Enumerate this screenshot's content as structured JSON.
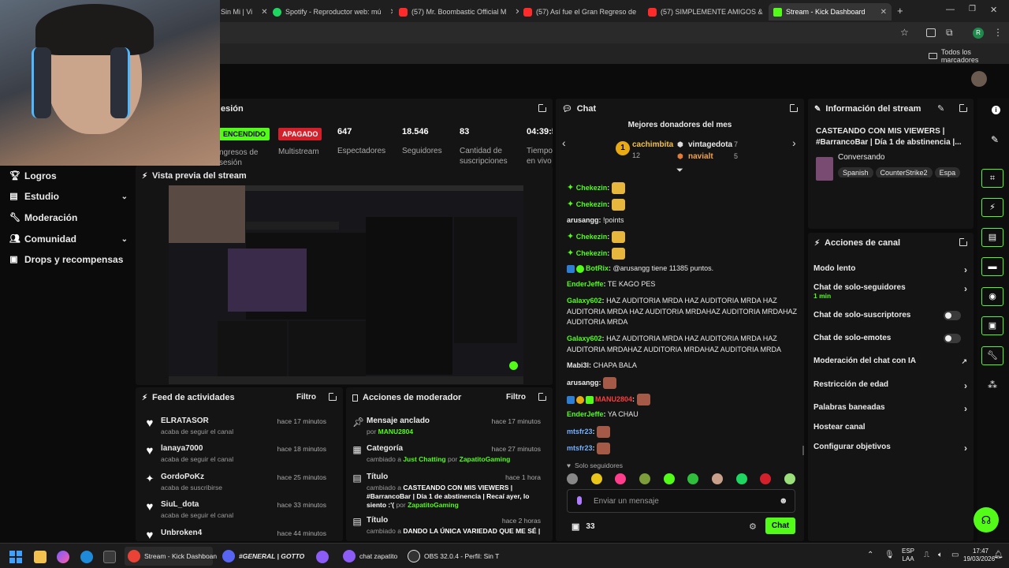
{
  "browser": {
    "tabs": [
      {
        "label": "Sin Mi | Vi",
        "color": "#888888"
      },
      {
        "label": "Spotify - Reproductor web: mú",
        "color": "#1ed760"
      },
      {
        "label": "(57) Mr. Boombastic Official M",
        "color": "#ff2b2b"
      },
      {
        "label": "(57) Así fue el Gran Regreso de",
        "color": "#ff2b2b"
      },
      {
        "label": "(57) SIMPLEMENTE AMIGOS &",
        "color": "#ff2b2b"
      },
      {
        "label": "Stream - Kick Dashboard",
        "color": "#53fc18"
      }
    ],
    "bookmarks_label": "Todos los marcadores",
    "profile_initial": "R"
  },
  "stats": {
    "session_title": "esión",
    "session_status": "ENCENDIDO",
    "session_label": "ngresos de sesión",
    "multistream_status": "APAGADO",
    "multistream_label": "Multistream",
    "viewers_value": "647",
    "viewers_label": "Espectadores",
    "followers_value": "18.546",
    "followers_label": "Seguidores",
    "subs_value": "83",
    "subs_label": "Cantidad de suscripciones",
    "time_value": "04:39:5",
    "time_label": "Tiempo en vivo"
  },
  "sidebar": {
    "items": [
      {
        "label": "Logros",
        "icon": "trophy-icon",
        "chevron": false
      },
      {
        "label": "Estudio",
        "icon": "book-icon",
        "chevron": true
      },
      {
        "label": "Moderación",
        "icon": "wrench-icon",
        "chevron": false
      },
      {
        "label": "Comunidad",
        "icon": "people-icon",
        "chevron": true
      },
      {
        "label": "Drops y recompensas",
        "icon": "gift-icon",
        "chevron": false
      }
    ]
  },
  "preview": {
    "title": "Vista previa del stream"
  },
  "feed": {
    "title": "Feed de actividades",
    "filter": "Filtro",
    "items": [
      {
        "name": "ELRATASOR",
        "desc": "acaba de seguir el canal",
        "time": "hace 17 minutos",
        "icon": "heart-icon"
      },
      {
        "name": "lanaya7000",
        "desc": "acaba de seguir el canal",
        "time": "hace 18 minutos",
        "icon": "heart-icon"
      },
      {
        "name": "GordoPoKz",
        "desc": "acaba de suscribirse",
        "time": "hace 25 minutos",
        "icon": "star-icon"
      },
      {
        "name": "SiuL_dota",
        "desc": "acaba de seguir el canal",
        "time": "hace 33 minutos",
        "icon": "heart-icon"
      },
      {
        "name": "Unbroken4",
        "desc": "",
        "time": "hace 44 minutos",
        "icon": "heart-icon"
      }
    ]
  },
  "modactions": {
    "title": "Acciones de moderador",
    "filter": "Filtro",
    "items": [
      {
        "name": "Mensaje anclado",
        "pre": "por ",
        "hl": "MANU2804",
        "mid": "",
        "hl2": "",
        "post": "",
        "time": "hace 17 minutos",
        "icon": "pin-icon"
      },
      {
        "name": "Categoría",
        "pre": "cambiado a ",
        "hl": "Just Chatting",
        "mid": " por ",
        "hl2": "ZapatitoGaming",
        "post": "",
        "time": "hace 27 minutos",
        "icon": "grid-icon"
      },
      {
        "name": "Título",
        "pre": "cambiado a ",
        "hl": "CASTEANDO CON MIS VIEWERS | #BarrancoBar | Día 1 de abstinencia | Recaí ayer, lo siento :'(",
        "mid": " por ",
        "hl2": "ZapatitoGaming",
        "post": "",
        "time": "hace 1 hora",
        "icon": "title-icon"
      },
      {
        "name": "Título",
        "pre": "cambiado a ",
        "hl": "DANDO LA ÚNICA VARIEDAD QUE ME SÉ |",
        "mid": "",
        "hl2": "",
        "post": "",
        "time": "hace 2 horas",
        "icon": "title-icon"
      }
    ]
  },
  "chat": {
    "title": "Chat",
    "donors_title": "Mejores donadores del mes",
    "donor1": {
      "name": "cachimbita",
      "amount": "12"
    },
    "donor2": {
      "name": "vintagedota",
      "amount": "7"
    },
    "donor3": {
      "name": "navialt",
      "amount": "5"
    },
    "messages": [
      {
        "user": "Chekezin",
        "text": "",
        "emote": true,
        "ucolor": "#53fc18"
      },
      {
        "user": "Chekezin",
        "text": "",
        "emote": true,
        "ucolor": "#53fc18"
      },
      {
        "user": "arusangg",
        "text": "!points",
        "emote": false,
        "ucolor": "#f0f0f0"
      },
      {
        "user": "Chekezin",
        "text": "",
        "emote": true,
        "ucolor": "#53fc18"
      },
      {
        "user": "Chekezin",
        "text": "",
        "emote": true,
        "ucolor": "#53fc18"
      },
      {
        "user": "BotRix",
        "text": "@arusangg tiene 11385 puntos.",
        "emote": false,
        "ucolor": "#53fc18"
      },
      {
        "user": "EnderJeffe",
        "text": "TE KAGO PES",
        "emote": false,
        "ucolor": "#53fc18"
      },
      {
        "user": "Galaxy602",
        "text": "HAZ AUDITORIA MRDA HAZ AUDITORIA MRDA HAZ AUDITORIA MRDA HAZ AUDITORIA MRDAHAZ AUDITORIA MRDAHAZ AUDITORIA MRDA",
        "emote": false,
        "ucolor": "#53fc18"
      },
      {
        "user": "Galaxy602",
        "text": "HAZ AUDITORIA MRDA HAZ AUDITORIA MRDA HAZ AUDITORIA MRDAHAZ AUDITORIA MRDAHAZ AUDITORIA MRDA",
        "emote": false,
        "ucolor": "#53fc18"
      },
      {
        "user": "Mabi3l",
        "text": "CHAPA BALA",
        "emote": false,
        "ucolor": "#f0f0f0"
      },
      {
        "user": "arusangg",
        "text": "",
        "emote": true,
        "ucolor": "#f0f0f0"
      },
      {
        "user": "MANU2804",
        "text": "",
        "emote": true,
        "ucolor": "#ff3d3d"
      },
      {
        "user": "EnderJeffe",
        "text": "YA CHAU",
        "emote": false,
        "ucolor": "#53fc18"
      },
      {
        "user": "mtsfr23",
        "text": "",
        "emote": true,
        "ucolor": "#74b0ff"
      },
      {
        "user": "mtsfr23",
        "text": "",
        "emote": true,
        "ucolor": "#74b0ff"
      }
    ],
    "followers_only": "Solo seguidores",
    "placeholder": "Enviar un mensaje",
    "count": "33",
    "send": "Chat"
  },
  "streaminfo": {
    "title": "Información del stream",
    "stream_title": "CASTEANDO CON MIS VIEWERS | #BarrancoBar | Día 1 de abstinencia |...",
    "category": "Conversando",
    "tags": [
      "Spanish",
      "CounterStrike2",
      "Espa"
    ]
  },
  "actions": {
    "title": "Acciones de canal",
    "items": [
      {
        "label": "Modo lento",
        "sub": "",
        "kind": "chevron"
      },
      {
        "label": "Chat de solo-seguidores",
        "sub": "1 min",
        "kind": "chevron"
      },
      {
        "label": "Chat de solo-suscriptores",
        "sub": "",
        "kind": "toggle"
      },
      {
        "label": "Chat de solo-emotes",
        "sub": "",
        "kind": "toggle"
      },
      {
        "label": "Moderación del chat con IA",
        "sub": "",
        "kind": "external"
      },
      {
        "label": "Restricción de edad",
        "sub": "",
        "kind": "chevron"
      },
      {
        "label": "Palabras baneadas",
        "sub": "",
        "kind": "chevron"
      },
      {
        "label": "Hostear canal",
        "sub": "",
        "kind": "none"
      },
      {
        "label": "Configurar objetivos",
        "sub": "",
        "kind": "chevron"
      }
    ]
  },
  "taskbar": {
    "apps": [
      {
        "label": "Stream - Kick Dashboan",
        "color": "#ea4335"
      },
      {
        "label": "#GENERAL | GOTTO",
        "color": "#5865f2"
      },
      {
        "label": "chat zapatito",
        "color": "#8b5cf6"
      },
      {
        "label": "OBS 32.0.4 - Perfil: Sin T",
        "color": "#444444"
      }
    ],
    "lang1": "ESP",
    "lang2": "LAA",
    "time": "17:47",
    "date": "19/03/2026"
  },
  "colors": {
    "accent": "#53fc18",
    "danger": "#d4202b",
    "panel": "#141414"
  }
}
